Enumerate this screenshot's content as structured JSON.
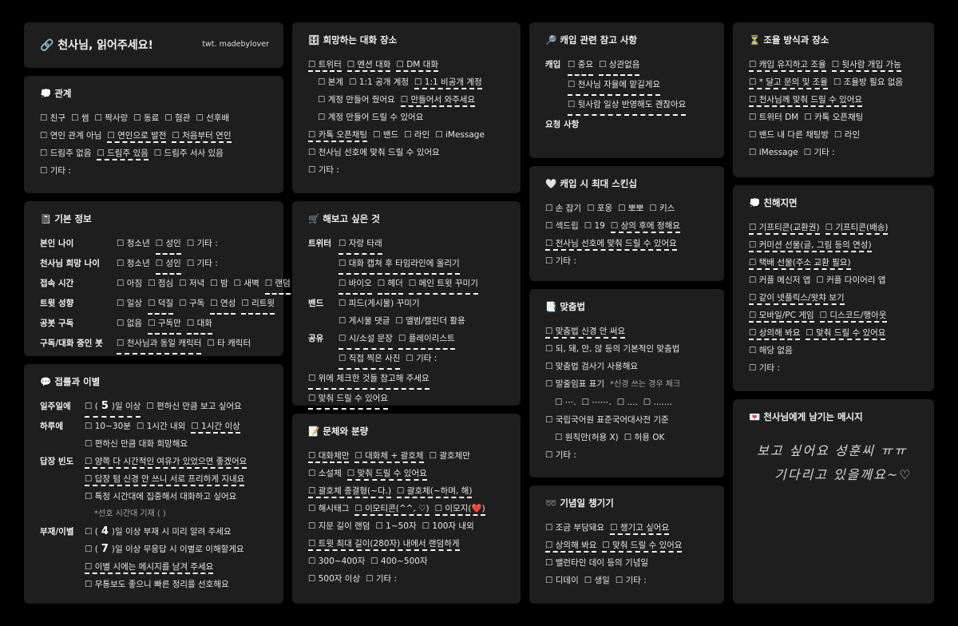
{
  "title_card": {
    "title": "🔗 천사님, 읽어주세요!",
    "credit": "twt. madebylover"
  },
  "rel": {
    "title": "💭 관계",
    "rows": [
      [
        {
          "t": "☐ 친구",
          "s": false
        },
        {
          "t": "☐ 썸",
          "s": false
        },
        {
          "t": "☐ 짝사랑",
          "s": false
        },
        {
          "t": "☐ 동료",
          "s": false
        },
        {
          "t": "☐ 혐관",
          "s": false
        },
        {
          "t": "☐ 선후배",
          "s": false
        }
      ],
      [
        {
          "t": "☐ 연인 관계 아님",
          "s": false
        },
        {
          "t": "☐ 연인으로 발전",
          "s": true
        },
        {
          "t": "☐ 처음부터 연인",
          "s": true
        }
      ],
      [
        {
          "t": "☐ 드림주 없음",
          "s": false
        },
        {
          "t": "☐ 드림주 있음",
          "s": true
        },
        {
          "t": "☐ 드림주 서사 있음",
          "s": false
        }
      ],
      [
        {
          "t": "☐ 기타 :",
          "s": false
        }
      ]
    ]
  },
  "basic": {
    "title": "📓 기본 정보",
    "rows": [
      {
        "label": "본인 나이",
        "opts": [
          {
            "t": "☐ 청소년",
            "s": false
          },
          {
            "t": "☐ 성인",
            "s": true
          },
          {
            "t": "☐ 기타 :",
            "s": false
          }
        ]
      },
      {
        "label": "천사님 희망 나이",
        "opts": [
          {
            "t": "☐ 청소년",
            "s": false
          },
          {
            "t": "☐ 성인",
            "s": true
          },
          {
            "t": "☐ 기타 :",
            "s": false
          }
        ]
      },
      {
        "label": "접속 시간",
        "opts": [
          {
            "t": "☐ 아침",
            "s": false
          },
          {
            "t": "☐ 점심",
            "s": false
          },
          {
            "t": "☐ 저녁",
            "s": false
          },
          {
            "t": "☐ 밤",
            "s": false
          },
          {
            "t": "☐ 새벽",
            "s": false
          },
          {
            "t": "☐ 랜덤",
            "s": true
          }
        ]
      },
      {
        "label": "트윗 성향",
        "opts": [
          {
            "t": "☐ 일상",
            "s": false
          },
          {
            "t": "☐ 덕질",
            "s": true
          },
          {
            "t": "☐ 구독",
            "s": false
          },
          {
            "t": "☐ 연성",
            "s": true
          },
          {
            "t": "☐ 리트윗",
            "s": true
          }
        ]
      },
      {
        "label": "공봇 구독",
        "opts": [
          {
            "t": "☐ 없음",
            "s": false
          },
          {
            "t": "☐ 구독만",
            "s": true
          },
          {
            "t": "☐ 대화",
            "s": true
          }
        ]
      },
      {
        "label": "구독/대화 중인 봇",
        "opts": [
          {
            "t": "☐ 천사님과 동일 캐릭터",
            "s": true
          },
          {
            "t": "☐ 타 캐릭터",
            "s": false
          }
        ]
      }
    ]
  },
  "meet": {
    "title": "💬 접률과 이별",
    "week_label": "일주일에",
    "week_pre": "☐ (",
    "week_num": "5",
    "week_post": ")일 이상",
    "week_opt2": "☐ 편하신 만큼 보고 싶어요",
    "day_label": "하루에",
    "day_opts": [
      {
        "t": "☐ 10~30분",
        "s": false
      },
      {
        "t": "☐ 1시간 내외",
        "s": false
      },
      {
        "t": "☐ 1시간 이상",
        "s": true
      }
    ],
    "day_opt2": "☐ 편하신 만큼  대화 희망해요",
    "reply_label": "답장 빈도",
    "reply_opts": [
      {
        "t": "☐ 양쪽 다 시간적인 여유가 있었으면 좋겠어요",
        "s": true
      },
      {
        "t": "☐ 답장 텀 신경 안 쓰니 서로 프리하게 지내요",
        "s": true
      },
      {
        "t": "☐ 특정 시간대에 집중해서 대화하고 싶어요",
        "s": false
      }
    ],
    "reply_note": "*선호 시간대 기재 (                              )",
    "absence_label": "부재/이별",
    "abs1_pre": "☐ (",
    "abs1_num": "4",
    "abs1_post": ")일 이상 부재 시 미리 알려 주세요",
    "abs2_pre": "☐ (",
    "abs2_num": "7",
    "abs2_post": ")일 이상 무응답 시 이별로 이해할게요",
    "abs3": "☐ 이별 시에는 메시지를 남겨 주세요",
    "abs4": "☐ 무통보도 좋으니 빠른 정리를 선호해요"
  },
  "place": {
    "title": "🗄 희망하는 대화 장소",
    "rows": [
      {
        "indent": 0,
        "opts": [
          {
            "t": "☐ 트위터",
            "s": true
          },
          {
            "t": "☐ 멘션 대화",
            "s": true
          },
          {
            "t": "☐ DM 대화",
            "s": true
          }
        ]
      },
      {
        "indent": 1,
        "opts": [
          {
            "t": "☐ 본계",
            "s": false
          },
          {
            "t": "☐ 1:1 공개 계정",
            "s": false
          },
          {
            "t": "☐ 1:1 비공개 계정",
            "s": true
          }
        ]
      },
      {
        "indent": 1,
        "opts": [
          {
            "t": "☐ 계정 만들어 줬어요",
            "s": false
          },
          {
            "t": "☐ 만들어서 와주세요",
            "s": true
          }
        ]
      },
      {
        "indent": 1,
        "opts": [
          {
            "t": "☐ 계정 만들어 드릴 수 있어요",
            "s": false
          }
        ]
      },
      {
        "indent": 0,
        "opts": [
          {
            "t": "☐ 카톡 오픈채팅",
            "s": true
          },
          {
            "t": "☐ 밴드",
            "s": false
          },
          {
            "t": "☐ 라인",
            "s": false
          },
          {
            "t": "☐ iMessage",
            "s": false
          }
        ]
      },
      {
        "indent": 0,
        "opts": [
          {
            "t": "☐ 천사님 선호에 맞춰 드릴 수 있어요",
            "s": false
          }
        ]
      },
      {
        "indent": 0,
        "opts": [
          {
            "t": "☐ 기타 :",
            "s": false
          }
        ]
      }
    ]
  },
  "try": {
    "title": "🛒 해보고 싶은 것",
    "rows": [
      {
        "label": "트위터",
        "opts": [
          {
            "t": "☐ 자랑 타래",
            "s": true
          }
        ]
      },
      {
        "label": "",
        "opts": [
          {
            "t": "☐ 대화 캡쳐 후 타임라인에 올리기",
            "s": true
          }
        ]
      },
      {
        "label": "",
        "opts": [
          {
            "t": "☐ 바이오",
            "s": true
          },
          {
            "t": "☐ 헤더",
            "s": true
          },
          {
            "t": "☐ 메인 트윗 꾸미기",
            "s": true
          }
        ]
      },
      {
        "label": "밴드",
        "opts": [
          {
            "t": "☐ 피드(게시물) 꾸미기",
            "s": false
          }
        ]
      },
      {
        "label": "",
        "opts": [
          {
            "t": "☐ 게시물 댓글",
            "s": false
          },
          {
            "t": "☐ 앨범/캘린더 활용",
            "s": false
          }
        ]
      },
      {
        "label": "공유",
        "opts": [
          {
            "t": "☐ 시/소설 문장",
            "s": true
          },
          {
            "t": "☐ 플레이리스트",
            "s": true
          }
        ]
      },
      {
        "label": "",
        "opts": [
          {
            "t": "☐ 직접 찍은 사진",
            "s": true
          },
          {
            "t": "☐ 기타 :",
            "s": false
          }
        ]
      },
      {
        "label": "",
        "full": true,
        "opts": [
          {
            "t": "☐ 위에 체크한 것들 참고해 주세요",
            "s": true
          }
        ]
      },
      {
        "label": "",
        "full": true,
        "opts": [
          {
            "t": "☐ 맞춰 드릴 수 있어요",
            "s": true
          }
        ]
      }
    ]
  },
  "style": {
    "title": "📝 문체와 분량",
    "rows": [
      [
        {
          "t": "☐ 대화체만",
          "s": true
        },
        {
          "t": "☐ 대화체 + 괄호체",
          "s": true
        },
        {
          "t": "☐ 괄호체만",
          "s": false
        }
      ],
      [
        {
          "t": "☐ 소설체",
          "s": false
        },
        {
          "t": "☐ 맞춰 드릴 수 있어요",
          "s": true
        }
      ],
      [
        {
          "t": "☐ 괄호체 종결형(~다.)",
          "s": true
        },
        {
          "t": "☐ 괄호체(~하며, 해)",
          "s": true
        }
      ],
      [
        {
          "t": "☐ 해시태그",
          "s": false
        },
        {
          "t": "☐ 이모티콘(^^, ♡)",
          "s": true
        },
        {
          "t": "☐ 이모지(❤️)",
          "s": true
        }
      ],
      [
        {
          "t": "☐ 지문 길이 랜덤",
          "s": false
        },
        {
          "t": "☐ 1~50자",
          "s": false
        },
        {
          "t": "☐ 100자 내외",
          "s": false
        }
      ],
      [
        {
          "t": "☐ 트윗 최대 길이(280자) 내에서 랜덤하게",
          "s": true
        }
      ],
      [
        {
          "t": "☐ 300~400자",
          "s": false
        },
        {
          "t": "☐ 400~500자",
          "s": false
        }
      ],
      [
        {
          "t": "☐ 500자 이상",
          "s": false
        },
        {
          "t": "☐ 기타 :",
          "s": false
        }
      ]
    ]
  },
  "capref": {
    "title": "🔎 캐입 관련 참고 사항",
    "cap_label": "캐입",
    "rows": [
      {
        "label": "캐입",
        "opts": [
          {
            "t": "☐ 중요",
            "s": true
          },
          {
            "t": "☐ 상관없음",
            "s": true
          }
        ]
      },
      {
        "label": "",
        "opts": [
          {
            "t": "☐ 천사님 자율에 맡길게요",
            "s": true
          }
        ]
      },
      {
        "label": "",
        "opts": [
          {
            "t": "☐ 뒷사람 일상 반영해도 괜찮아요",
            "s": true
          }
        ]
      },
      {
        "label": "요청 사항",
        "opts": []
      }
    ]
  },
  "skin": {
    "title": "🤍 캐입 시 최대 스킨십",
    "rows": [
      [
        {
          "t": "☐ 손 잡기",
          "s": false
        },
        {
          "t": "☐ 포옹",
          "s": false
        },
        {
          "t": "☐ 뽀뽀",
          "s": false
        },
        {
          "t": "☐ 키스",
          "s": false
        }
      ],
      [
        {
          "t": "☐ 섹드립",
          "s": false
        },
        {
          "t": "☐ 19",
          "s": false
        },
        {
          "t": "☐ 상의 후에 정해요",
          "s": true
        }
      ],
      [
        {
          "t": "☐ 천사님 선호에 맞춰 드릴 수 있어요",
          "s": true
        }
      ],
      [
        {
          "t": "☐ 기타 :",
          "s": false
        }
      ]
    ]
  },
  "spell": {
    "title": "📑 맞춤법",
    "rows": [
      {
        "indent": 0,
        "opts": [
          {
            "t": "☐ 맞춤법 신경 안 써요",
            "s": true
          }
        ]
      },
      {
        "indent": 0,
        "opts": [
          {
            "t": "☐ 되, 돼, 안, 않 등의 기본적인 맞춤법",
            "s": false
          }
        ]
      },
      {
        "indent": 0,
        "opts": [
          {
            "t": "☐ 맞춤법 검사기 사용해요",
            "s": false
          }
        ]
      },
      {
        "indent": 0,
        "opts": [
          {
            "t": "☐ 말줄임표 표기",
            "s": false
          }
        ],
        "note": "*신경 쓰는 경우 체크"
      },
      {
        "indent": 1,
        "opts": [
          {
            "t": "☐ ⋯.",
            "s": false
          },
          {
            "t": "☐ ⋯⋯.",
            "s": false
          },
          {
            "t": "☐ ....",
            "s": false
          },
          {
            "t": "☐ .......",
            "s": false
          }
        ]
      },
      {
        "indent": 0,
        "opts": [
          {
            "t": "☐ 국립국어원 표준국어대사전 기준",
            "s": false
          }
        ]
      },
      {
        "indent": 1,
        "opts": [
          {
            "t": "☐ 원칙만(허용 X)",
            "s": false
          },
          {
            "t": "☐ 허용 OK",
            "s": false
          }
        ]
      },
      {
        "indent": 0,
        "opts": [
          {
            "t": "☐ 기타 :",
            "s": false
          }
        ]
      }
    ]
  },
  "anniv": {
    "title": "➿ 기념일 챙기기",
    "rows": [
      [
        {
          "t": "☐ 조금 부담돼요",
          "s": false
        },
        {
          "t": "☐ 챙기고 싶어요",
          "s": true
        }
      ],
      [
        {
          "t": "☐ 상의해 봐요",
          "s": true
        },
        {
          "t": "☐ 맞춰 드릴 수 있어요",
          "s": true
        }
      ],
      [
        {
          "t": "☐ 밸런타인 데이 등의 기념일",
          "s": false
        }
      ],
      [
        {
          "t": "☐ 디데이",
          "s": false
        },
        {
          "t": "☐ 생일",
          "s": false
        },
        {
          "t": "☐ 기타 :",
          "s": false
        }
      ]
    ]
  },
  "adjust": {
    "title": "⏳ 조율 방식과 장소",
    "rows": [
      [
        {
          "t": "☐ 캐입 유지하고 조율",
          "s": true
        },
        {
          "t": "☐ 뒷사람 개입 가능",
          "s": true
        }
      ],
      [
        {
          "t": "☐ * 달고 문의 및 조율",
          "s": true
        },
        {
          "t": "☐ 조율방 필요 없음",
          "s": false
        }
      ],
      [
        {
          "t": "☐ 천사님께 맞춰 드릴 수 있어요",
          "s": true
        }
      ],
      [
        {
          "t": "☐ 트위터 DM",
          "s": false
        },
        {
          "t": "☐ 카톡 오픈채팅",
          "s": false
        }
      ],
      [
        {
          "t": "☐ 밴드 내 다른 채팅방",
          "s": false
        },
        {
          "t": "☐ 라인",
          "s": false
        }
      ],
      [
        {
          "t": "☐ iMessage",
          "s": false
        },
        {
          "t": "☐ 기타 :",
          "s": false
        }
      ]
    ]
  },
  "friend": {
    "title": "💭 친해지면",
    "rows": [
      [
        {
          "t": "☐ 기프티콘(교환권)",
          "s": true
        },
        {
          "t": "☐ 기프티콘(배송)",
          "s": true
        }
      ],
      [
        {
          "t": "☐ 커미션 선물(글, 그림 등의 연성)",
          "s": true
        }
      ],
      [
        {
          "t": "☐ 택배 선물(주소 교환 필요)",
          "s": true
        }
      ],
      [
        {
          "t": "☐ 커플 메신저 앱",
          "s": false
        },
        {
          "t": "☐ 커플 다이어리 앱",
          "s": false
        }
      ],
      [
        {
          "t": "☐ 같이 넷플릭스/왓챠 보기",
          "s": true
        }
      ],
      [
        {
          "t": "☐ 모바일/PC 게임",
          "s": true
        },
        {
          "t": "☐ 디스코드/행아웃",
          "s": true
        }
      ],
      [
        {
          "t": "☐ 상의해 봐요",
          "s": true
        },
        {
          "t": "☐ 맞춰 드릴 수 있어요",
          "s": true
        }
      ],
      [
        {
          "t": "☐ 해당 없음",
          "s": false
        }
      ],
      [
        {
          "t": "☐ 기타 :",
          "s": false
        }
      ]
    ]
  },
  "msg": {
    "title": "💌 천사님에게 남기는 메시지",
    "line1": "보고 싶어요 성훈씨 ㅠㅠ",
    "line2": "기다리고 있을께요~♡"
  }
}
